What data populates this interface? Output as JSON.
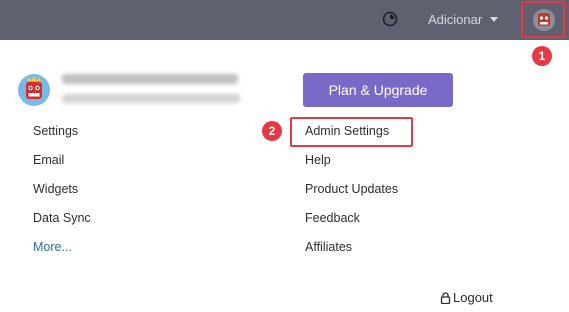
{
  "topbar": {
    "add_label": "Adicionar",
    "background": "#5f6171"
  },
  "annotations": {
    "badge_1": "1",
    "badge_2": "2",
    "highlight_color": "#e53945"
  },
  "profile_menu": {
    "plan_button_label": "Plan & Upgrade",
    "left_items": [
      {
        "label": "Settings"
      },
      {
        "label": "Email"
      },
      {
        "label": "Widgets"
      },
      {
        "label": "Data Sync"
      },
      {
        "label": "More..."
      }
    ],
    "right_items": [
      {
        "label": "Admin Settings"
      },
      {
        "label": "Help"
      },
      {
        "label": "Product Updates"
      },
      {
        "label": "Feedback"
      },
      {
        "label": "Affiliates"
      }
    ],
    "logout_label": "Logout",
    "accent_color": "#7b69c7",
    "link_color": "#2b6ea8"
  },
  "icons": [
    "clock-icon",
    "chevron-down-icon",
    "avatar-icon",
    "lock-icon"
  ]
}
